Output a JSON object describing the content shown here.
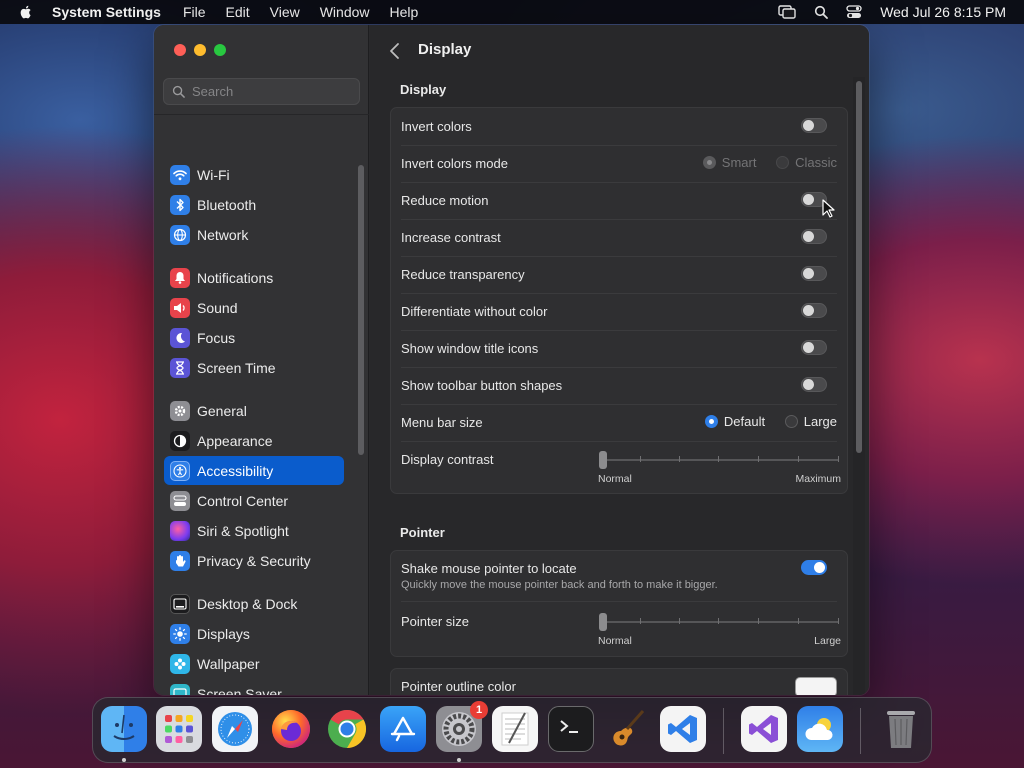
{
  "menubar": {
    "app_name": "System Settings",
    "items": [
      "File",
      "Edit",
      "View",
      "Window",
      "Help"
    ],
    "clock": "Wed Jul 26  8:15 PM"
  },
  "sidebar": {
    "search_placeholder": "Search",
    "items": [
      {
        "label": "Wi-Fi",
        "icon": "wifi-icon",
        "color": "#2f7fe8"
      },
      {
        "label": "Bluetooth",
        "icon": "bluetooth-icon",
        "color": "#2f7fe8"
      },
      {
        "label": "Network",
        "icon": "globe-icon",
        "color": "#2f7fe8"
      },
      {
        "label": "Notifications",
        "icon": "bell-icon",
        "color": "#e8434b"
      },
      {
        "label": "Sound",
        "icon": "speaker-icon",
        "color": "#e8434b"
      },
      {
        "label": "Focus",
        "icon": "moon-icon",
        "color": "#5b54d6"
      },
      {
        "label": "Screen Time",
        "icon": "hourglass-icon",
        "color": "#5b54d6"
      },
      {
        "label": "General",
        "icon": "gear-icon",
        "color": "#8e8e93"
      },
      {
        "label": "Appearance",
        "icon": "appearance-icon",
        "color": "#1c1c1e"
      },
      {
        "label": "Accessibility",
        "icon": "accessibility-icon",
        "color": "#2f7fe8"
      },
      {
        "label": "Control Center",
        "icon": "control-center-icon",
        "color": "#8e8e93"
      },
      {
        "label": "Siri & Spotlight",
        "icon": "siri-icon",
        "color": "#b05ad6"
      },
      {
        "label": "Privacy & Security",
        "icon": "hand-icon",
        "color": "#2f7fe8"
      },
      {
        "label": "Desktop & Dock",
        "icon": "dock-icon",
        "color": "#1c1c1e"
      },
      {
        "label": "Displays",
        "icon": "sun-icon",
        "color": "#2f7fe8"
      },
      {
        "label": "Wallpaper",
        "icon": "flower-icon",
        "color": "#2fb6e8"
      },
      {
        "label": "Screen Saver",
        "icon": "screensaver-icon",
        "color": "#2fb6c8"
      }
    ],
    "selected": "Accessibility"
  },
  "content": {
    "title": "Display",
    "display_section": {
      "title": "Display",
      "rows": {
        "invert_colors": {
          "label": "Invert colors",
          "on": false
        },
        "invert_mode": {
          "label": "Invert colors mode",
          "options": [
            "Smart",
            "Classic"
          ],
          "selected": "Smart",
          "disabled": true
        },
        "reduce_motion": {
          "label": "Reduce motion",
          "on": false
        },
        "increase_contrast": {
          "label": "Increase contrast",
          "on": false
        },
        "reduce_transparency": {
          "label": "Reduce transparency",
          "on": false
        },
        "differentiate": {
          "label": "Differentiate without color",
          "on": false
        },
        "title_icons": {
          "label": "Show window title icons",
          "on": false
        },
        "toolbar_shapes": {
          "label": "Show toolbar button shapes",
          "on": false
        },
        "menu_bar_size": {
          "label": "Menu bar size",
          "options": [
            "Default",
            "Large"
          ],
          "selected": "Default"
        },
        "display_contrast": {
          "label": "Display contrast",
          "min_label": "Normal",
          "max_label": "Maximum",
          "value": 0
        }
      }
    },
    "pointer_section": {
      "title": "Pointer",
      "shake": {
        "label": "Shake mouse pointer to locate",
        "description": "Quickly move the mouse pointer back and forth to make it bigger.",
        "on": true
      },
      "pointer_size": {
        "label": "Pointer size",
        "min_label": "Normal",
        "max_label": "Large",
        "value": 0
      },
      "outline_color": {
        "label": "Pointer outline color",
        "color": "#ffffff"
      }
    }
  },
  "dock": {
    "apps": [
      "Finder",
      "Launchpad",
      "Safari",
      "Firefox",
      "Chrome",
      "App Store",
      "System Settings",
      "TextEdit",
      "Terminal",
      "GarageBand",
      "Visual Studio Code",
      "Visual Studio",
      "Weather",
      "Trash"
    ],
    "system_settings_badge": "1"
  }
}
